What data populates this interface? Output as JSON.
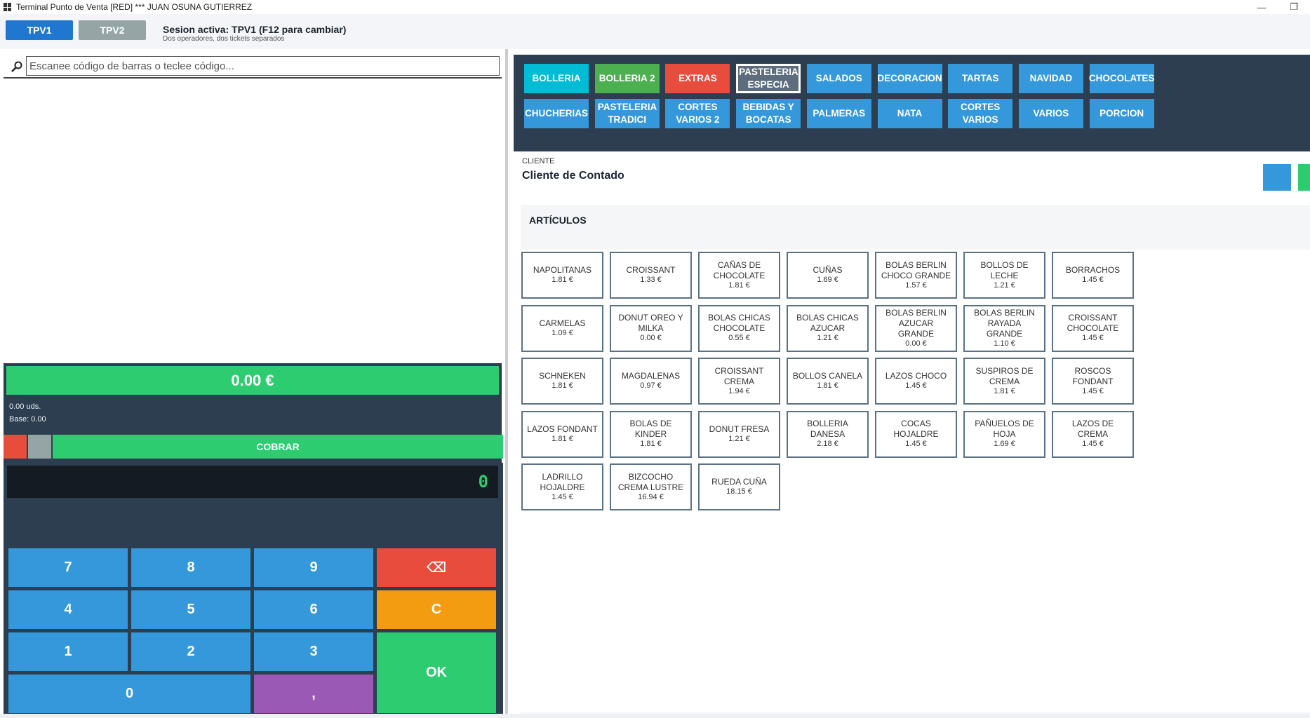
{
  "window": {
    "title": "Terminal Punto de Venta [RED] *** JUAN OSUNA GUTIERREZ",
    "minimize": "—",
    "restore": "❐"
  },
  "session": {
    "tab1": "TPV1",
    "tab2": "TPV2",
    "title": "Sesion activa: TPV1  (F12 para cambiar)",
    "subtitle": "Dos operadores, dos tickets separados"
  },
  "search": {
    "placeholder": "Escanee código de barras o teclee código..."
  },
  "totals": {
    "total": "0.00 €",
    "units": "0.00 uds.",
    "base": "Base: 0.00"
  },
  "actions": {
    "cobrar": "COBRAR"
  },
  "keypad": {
    "display": "0",
    "keys": {
      "k7": "7",
      "k8": "8",
      "k9": "9",
      "back": "⌫",
      "k4": "4",
      "k5": "5",
      "k6": "6",
      "clear": "C",
      "k1": "1",
      "k2": "2",
      "k3": "3",
      "ok": "OK",
      "k0": "0",
      "comma": ","
    }
  },
  "categories": [
    {
      "label": "BOLLERIA",
      "style": "cyan"
    },
    {
      "label": "BOLLERIA 2",
      "style": "green"
    },
    {
      "label": "EXTRAS",
      "style": "red"
    },
    {
      "label": "PASTELERIA ESPECIA",
      "style": "selected"
    },
    {
      "label": "SALADOS",
      "style": "blue"
    },
    {
      "label": "DECORACION",
      "style": "blue"
    },
    {
      "label": "TARTAS",
      "style": "blue"
    },
    {
      "label": "NAVIDAD",
      "style": "blue"
    },
    {
      "label": "CHOCOLATES",
      "style": "blue"
    },
    {
      "label": "CHUCHERIAS",
      "style": "blue"
    },
    {
      "label": "PASTELERIA TRADICI",
      "style": "blue"
    },
    {
      "label": "CORTES VARIOS 2",
      "style": "blue"
    },
    {
      "label": "BEBIDAS Y BOCATAS",
      "style": "blue"
    },
    {
      "label": "PALMERAS",
      "style": "blue"
    },
    {
      "label": "NATA",
      "style": "blue"
    },
    {
      "label": "CORTES VARIOS",
      "style": "blue"
    },
    {
      "label": "VARIOS",
      "style": "blue"
    },
    {
      "label": "PORCION",
      "style": "blue"
    }
  ],
  "client": {
    "label": "CLIENTE",
    "name": "Cliente de Contado"
  },
  "articles_header": "ARTÍCULOS",
  "articles": [
    {
      "name": "NAPOLITANAS",
      "price": "1.81 €"
    },
    {
      "name": "CROISSANT",
      "price": "1.33 €"
    },
    {
      "name": "CAÑAS DE CHOCOLATE",
      "price": "1.81 €"
    },
    {
      "name": "CUÑAS",
      "price": "1.69 €"
    },
    {
      "name": "BOLAS BERLIN CHOCO GRANDE",
      "price": "1.57 €"
    },
    {
      "name": "BOLLOS DE LECHE",
      "price": "1.21 €"
    },
    {
      "name": "BORRACHOS",
      "price": "1.45 €"
    },
    {
      "name": "CARMELAS",
      "price": "1.09 €"
    },
    {
      "name": "DONUT OREO Y MILKA",
      "price": "0.00 €"
    },
    {
      "name": "BOLAS CHICAS CHOCOLATE",
      "price": "0.55 €"
    },
    {
      "name": "BOLAS CHICAS AZUCAR",
      "price": "1.21 €"
    },
    {
      "name": "BOLAS BERLIN AZUCAR GRANDE",
      "price": "0.00 €"
    },
    {
      "name": "BOLAS BERLIN RAYADA GRANDE",
      "price": "1.10 €"
    },
    {
      "name": "CROISSANT CHOCOLATE",
      "price": "1.45 €"
    },
    {
      "name": "SCHNEKEN",
      "price": "1.81 €"
    },
    {
      "name": "MAGDALENAS",
      "price": "0.97 €"
    },
    {
      "name": "CROISSANT CREMA",
      "price": "1.94 €"
    },
    {
      "name": "BOLLOS CANELA",
      "price": "1.81 €"
    },
    {
      "name": "LAZOS CHOCO",
      "price": "1.45 €"
    },
    {
      "name": "SUSPIROS DE CREMA",
      "price": "1.81 €"
    },
    {
      "name": "ROSCOS FONDANT",
      "price": "1.45 €"
    },
    {
      "name": "LAZOS FONDANT",
      "price": "1.81 €"
    },
    {
      "name": "BOLAS DE KINDER",
      "price": "1.81 €"
    },
    {
      "name": "DONUT FRESA",
      "price": "1.21 €"
    },
    {
      "name": "BOLLERIA DANESA",
      "price": "2.18 €"
    },
    {
      "name": "COCAS HOJALDRE",
      "price": "1.45 €"
    },
    {
      "name": "PAÑUELOS DE HOJA",
      "price": "1.69 €"
    },
    {
      "name": "LAZOS DE CREMA",
      "price": "1.45 €"
    },
    {
      "name": "LADRILLO HOJALDRE",
      "price": "1.45 €"
    },
    {
      "name": "BIZCOCHO CREMA LUSTRE",
      "price": "16.94 €"
    },
    {
      "name": "RUEDA CUÑA",
      "price": "18.15 €"
    }
  ]
}
